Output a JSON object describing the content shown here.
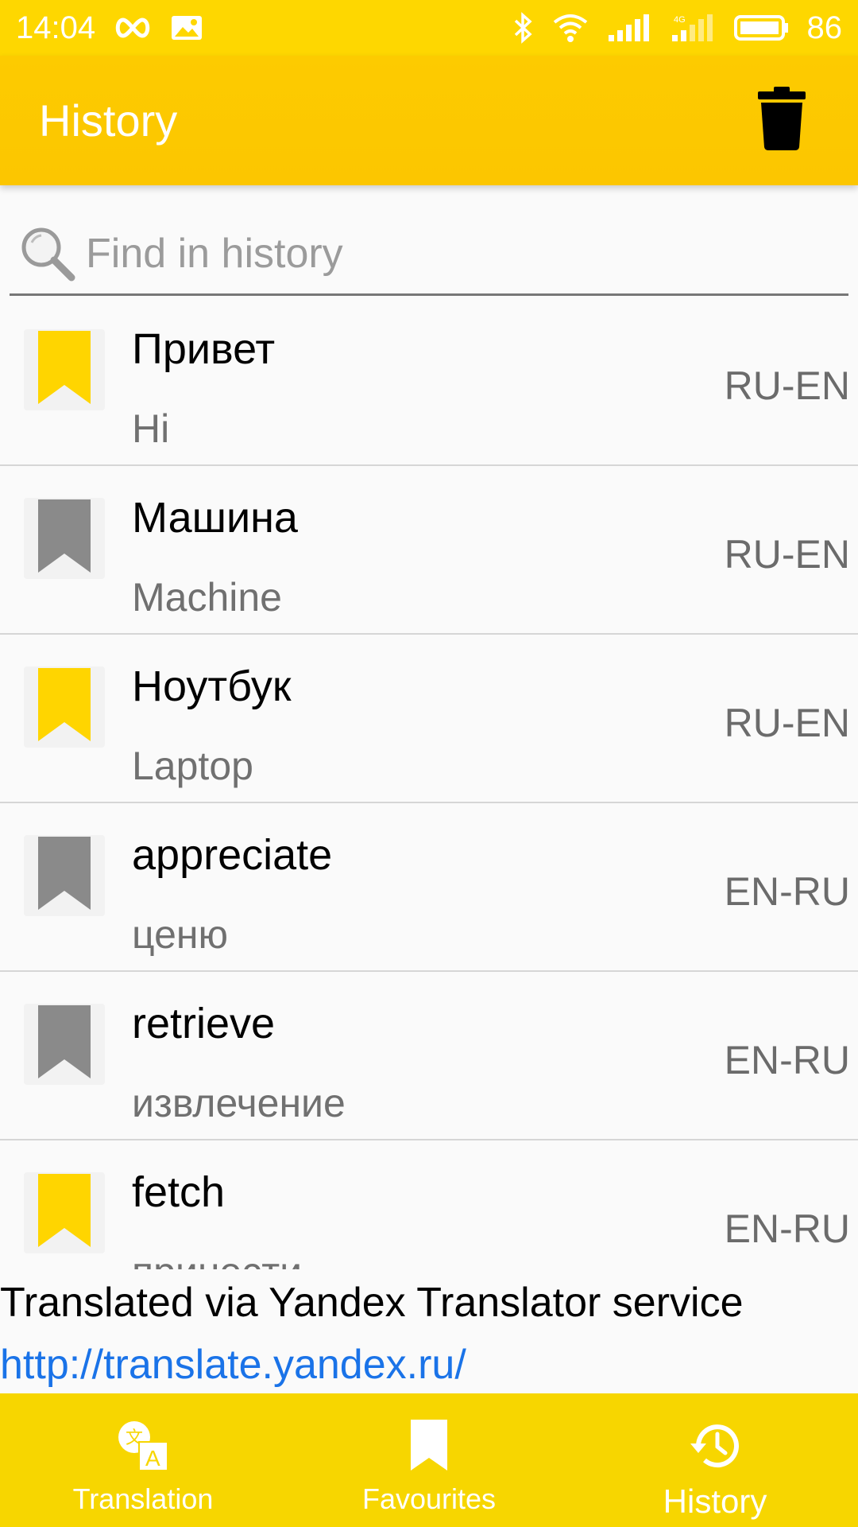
{
  "status_bar": {
    "time": "14:04",
    "battery": "86",
    "network": "4G"
  },
  "app_bar": {
    "title": "History",
    "delete_icon": "trash-icon"
  },
  "search": {
    "placeholder": "Find in history",
    "value": ""
  },
  "history": {
    "items": [
      {
        "word": "Привет",
        "translation": "Hi",
        "lang": "RU-EN",
        "favourite": true
      },
      {
        "word": "Машина",
        "translation": "Machine",
        "lang": "RU-EN",
        "favourite": false
      },
      {
        "word": "Ноутбук",
        "translation": "Laptop",
        "lang": "RU-EN",
        "favourite": true
      },
      {
        "word": "appreciate",
        "translation": "ценю",
        "lang": "EN-RU",
        "favourite": false
      },
      {
        "word": "retrieve",
        "translation": "извлечение",
        "lang": "EN-RU",
        "favourite": false
      },
      {
        "word": "fetch",
        "translation": "принести",
        "lang": "EN-RU",
        "favourite": true
      }
    ]
  },
  "attribution": {
    "text": "Translated via Yandex Translator service",
    "link": "http://translate.yandex.ru/"
  },
  "bottom_nav": {
    "items": [
      {
        "label": "Translation",
        "icon": "translate-icon",
        "active": false
      },
      {
        "label": "Favourites",
        "icon": "bookmark-icon",
        "active": false
      },
      {
        "label": "History",
        "icon": "history-icon",
        "active": true
      }
    ]
  },
  "colors": {
    "accent": "#fdcb00",
    "bookmark_on": "#ffd500",
    "bookmark_off": "#8a8a8a",
    "link": "#1a73e8"
  }
}
